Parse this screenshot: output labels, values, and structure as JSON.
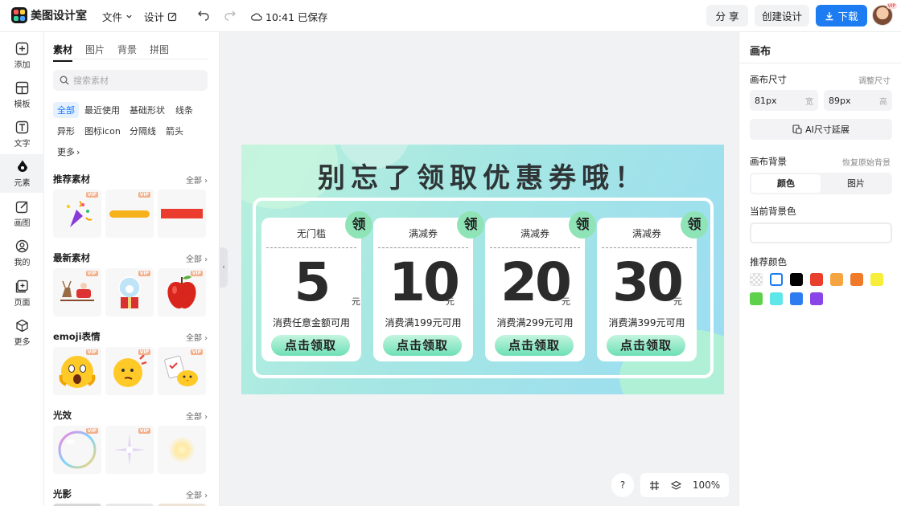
{
  "app": {
    "name": "美图设计室"
  },
  "topbar": {
    "file_menu": "文件",
    "design_menu": "设计",
    "save_status": "10:41 已保存",
    "share_label": "分 享",
    "create_label": "创建设计",
    "download_label": "下载",
    "vip_badge": "VIP"
  },
  "leftbar": {
    "items": [
      {
        "label": "添加",
        "icon": "plus-square-icon"
      },
      {
        "label": "模板",
        "icon": "template-icon"
      },
      {
        "label": "文字",
        "icon": "text-icon"
      },
      {
        "label": "元素",
        "icon": "shapes-icon"
      },
      {
        "label": "画图",
        "icon": "draw-icon"
      },
      {
        "label": "我的",
        "icon": "user-icon"
      },
      {
        "label": "页面",
        "icon": "page-add-icon"
      },
      {
        "label": "更多",
        "icon": "cube-icon"
      }
    ]
  },
  "panel": {
    "tabs": [
      "素材",
      "图片",
      "背景",
      "拼图"
    ],
    "search_placeholder": "搜索素材",
    "chips": [
      "全部",
      "最近使用",
      "基础形状",
      "线条",
      "异形",
      "图标icon",
      "分隔线",
      "箭头",
      "更多"
    ],
    "sections": [
      {
        "title": "推荐素材",
        "all": "全部"
      },
      {
        "title": "最新素材",
        "all": "全部"
      },
      {
        "title": "emoji表情",
        "all": "全部"
      },
      {
        "title": "光效",
        "all": "全部"
      },
      {
        "title": "光影",
        "all": "全部"
      }
    ],
    "vip": "VIP"
  },
  "canvas": {
    "headline": "别忘了领取优惠券哦！",
    "coupons": [
      {
        "title": "无门槛",
        "amount": "5",
        "unit": "元",
        "condition": "消费任意金额可用",
        "button": "点击领取",
        "badge": "领"
      },
      {
        "title": "满减券",
        "amount": "10",
        "unit": "元",
        "condition": "消费满199元可用",
        "button": "点击领取",
        "badge": "领"
      },
      {
        "title": "满减券",
        "amount": "20",
        "unit": "元",
        "condition": "消费满299元可用",
        "button": "点击领取",
        "badge": "领"
      },
      {
        "title": "满减券",
        "amount": "30",
        "unit": "元",
        "condition": "消费满399元可用",
        "button": "点击领取",
        "badge": "领"
      }
    ]
  },
  "bottom": {
    "help": "?",
    "zoom": "100%"
  },
  "rightpanel": {
    "title": "画布",
    "size_label": "画布尺寸",
    "resize_link": "调整尺寸",
    "width_value": "81px",
    "width_unit": "宽",
    "height_value": "89px",
    "height_unit": "高",
    "ai_extend": "AI尺寸延展",
    "bg_label": "画布背景",
    "restore_bg": "恢复原始背景",
    "seg_color": "颜色",
    "seg_image": "图片",
    "current_bg": "当前背景色",
    "recommended": "推荐颜色",
    "swatches": [
      "transparent",
      "#ffffff",
      "#000000",
      "#e8402c",
      "#f5a442",
      "#ee7a2a",
      "#f6ee3a",
      "#5ed14b",
      "#5ee6e8",
      "#2f7cf0",
      "#8a45e8"
    ]
  }
}
